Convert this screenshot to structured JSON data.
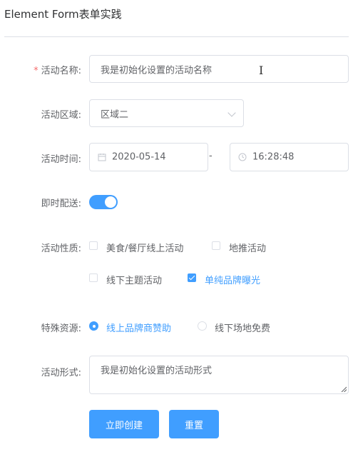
{
  "page": {
    "title": "Element Form表单实践"
  },
  "form": {
    "name": {
      "label": "活动名称:",
      "required_mark": "*",
      "value": "我是初始化设置的活动名称"
    },
    "region": {
      "label": "活动区域:",
      "selected": "区域二"
    },
    "time": {
      "label": "活动时间:",
      "date": "2020-05-14",
      "separator": "-",
      "clock": "16:28:48"
    },
    "delivery": {
      "label": "即时配送:",
      "on": true
    },
    "type": {
      "label": "活动性质:",
      "options": [
        {
          "label": "美食/餐厅线上活动",
          "checked": false
        },
        {
          "label": "地推活动",
          "checked": false
        },
        {
          "label": "线下主题活动",
          "checked": false
        },
        {
          "label": "单纯品牌曝光",
          "checked": true
        }
      ]
    },
    "resource": {
      "label": "特殊资源:",
      "options": [
        {
          "label": "线上品牌商赞助",
          "selected": true
        },
        {
          "label": "线下场地免费",
          "selected": false
        }
      ]
    },
    "desc": {
      "label": "活动形式:",
      "value": "我是初始化设置的活动形式"
    },
    "buttons": {
      "create": "立即创建",
      "reset": "重置"
    }
  },
  "colors": {
    "primary": "#409eff",
    "required": "#f56c6c",
    "border": "#dcdfe6",
    "text": "#606266"
  }
}
